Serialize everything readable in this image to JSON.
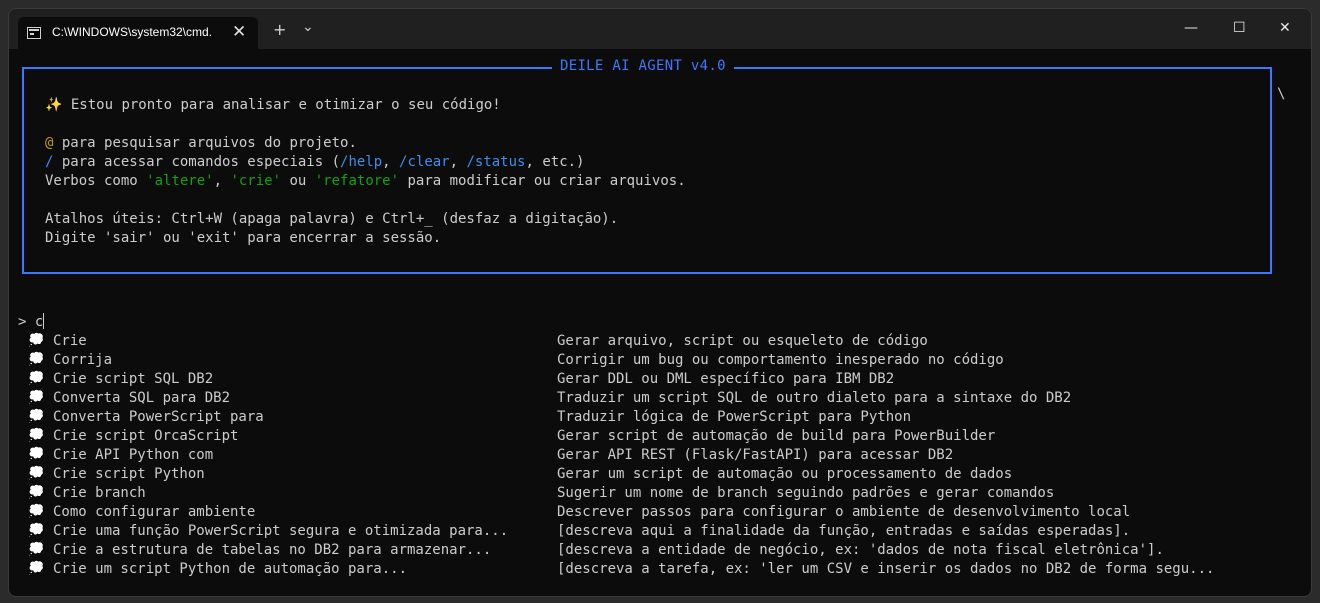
{
  "window": {
    "tab_title": "C:\\WINDOWS\\system32\\cmd.",
    "tab_close": "✕",
    "new_tab": "+",
    "dropdown": "⌄",
    "minimize": "—",
    "maximize": "☐",
    "close": "✕"
  },
  "panel": {
    "title": "DEILE AI AGENT v4.0",
    "welcome_icon": "✨",
    "welcome": " Estou pronto para analisar e otimizar o seu código!",
    "line_at_symbol": "@",
    "line_at_text": " para pesquisar arquivos do projeto.",
    "line_slash_symbol": "/",
    "line_slash_text1": " para acessar comandos especiais (",
    "cmd_help": "/help",
    "sep1": ", ",
    "cmd_clear": "/clear",
    "sep2": ", ",
    "cmd_status": "/status",
    "line_slash_text2": ", etc.)",
    "verbs_prefix": "Verbos como ",
    "verb1": "'altere'",
    "verbs_sep1": ", ",
    "verb2": "'crie'",
    "verbs_sep2": " ou ",
    "verb3": "'refatore'",
    "verbs_suffix": " para modificar ou criar arquivos.",
    "shortcuts": "Atalhos úteis: Ctrl+W (apaga palavra) e Ctrl+_ (desfaz a digitação).",
    "exit_hint": "Digite 'sair' ou 'exit' para encerrar a sessão."
  },
  "side_char": "\\",
  "prompt": {
    "symbol": "> ",
    "value": "c"
  },
  "suggestions": [
    {
      "icon": "💭",
      "cmd": "Crie",
      "desc": "Gerar arquivo, script ou esqueleto de código"
    },
    {
      "icon": "💭",
      "cmd": "Corrija",
      "desc": "Corrigir um bug ou comportamento inesperado no código"
    },
    {
      "icon": "💭",
      "cmd": "Crie script SQL DB2",
      "desc": "Gerar DDL ou DML específico para IBM DB2"
    },
    {
      "icon": "💭",
      "cmd": "Converta SQL para DB2",
      "desc": "Traduzir um script SQL de outro dialeto para a sintaxe do DB2"
    },
    {
      "icon": "💭",
      "cmd": "Converta PowerScript para",
      "desc": "Traduzir lógica de PowerScript para Python"
    },
    {
      "icon": "💭",
      "cmd": "Crie script OrcaScript",
      "desc": "Gerar script de automação de build para PowerBuilder"
    },
    {
      "icon": "💭",
      "cmd": "Crie API Python com",
      "desc": "Gerar API REST (Flask/FastAPI) para acessar DB2"
    },
    {
      "icon": "💭",
      "cmd": "Crie script Python",
      "desc": "Gerar um script de automação ou processamento de dados"
    },
    {
      "icon": "💭",
      "cmd": "Crie branch",
      "desc": "Sugerir um nome de branch seguindo padrões e gerar comandos"
    },
    {
      "icon": "💭",
      "cmd": "Como configurar ambiente",
      "desc": "Descrever passos para configurar o ambiente de desenvolvimento local"
    },
    {
      "icon": "💭",
      "cmd": "Crie uma função PowerScript segura e otimizada para...",
      "desc": "[descreva aqui a finalidade da função, entradas e saídas esperadas]."
    },
    {
      "icon": "💭",
      "cmd": "Crie a estrutura de tabelas no DB2 para armazenar...",
      "desc": "[descreva a entidade de negócio, ex: 'dados de nota fiscal eletrônica']."
    },
    {
      "icon": "💭",
      "cmd": "Crie um script Python de automação para...",
      "desc": "[descreva a tarefa, ex: 'ler um CSV e inserir os dados no DB2 de forma segu..."
    }
  ]
}
